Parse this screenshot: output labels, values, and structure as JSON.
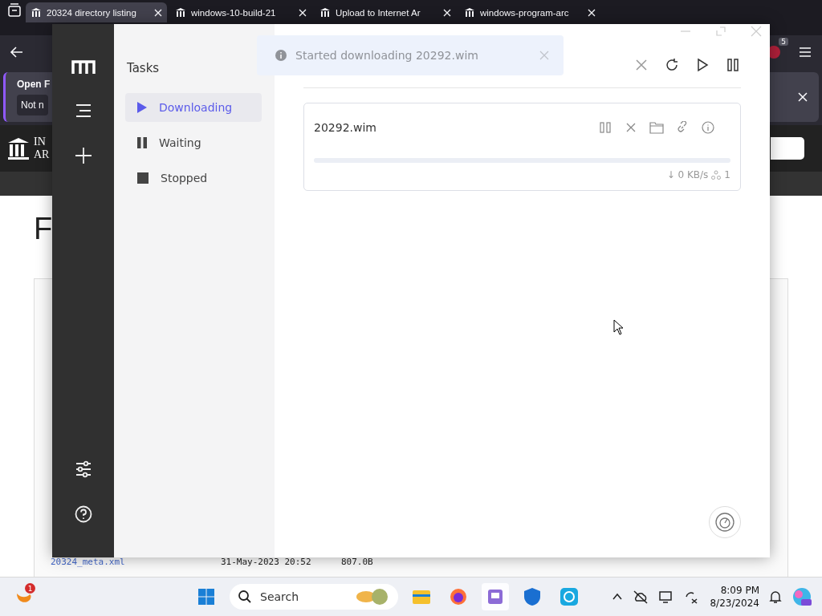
{
  "browser": {
    "tabs": [
      {
        "title": "20324 directory listing",
        "selected": true
      },
      {
        "title": "windows-10-build-21",
        "selected": false
      },
      {
        "title": "Upload to Internet Ar",
        "selected": false
      },
      {
        "title": "windows-program-arc",
        "selected": false
      }
    ],
    "extension_badge": "5",
    "notification": {
      "title": "Open F",
      "button": "Not n"
    },
    "site": {
      "logo_lines": [
        "IN",
        "AR"
      ],
      "heading": "F",
      "files": [
        {
          "name": "20324_meta.xml",
          "date": "31-May-2023 20:52",
          "size": "807.0B"
        }
      ]
    }
  },
  "motrix": {
    "sidebar_title": "Tasks",
    "categories": [
      {
        "label": "Downloading",
        "kind": "play",
        "selected": true
      },
      {
        "label": "Waiting",
        "kind": "pause",
        "selected": false
      },
      {
        "label": "Stopped",
        "kind": "stop",
        "selected": false
      }
    ],
    "toast": "Started downloading 20292.wim",
    "tasks": [
      {
        "name": "20292.wim",
        "level": 0,
        "speed": "↓ 0 KB/s",
        "connections": "1"
      }
    ]
  },
  "taskbar": {
    "notification_count": "1",
    "search_placeholder": "Search",
    "time": "8:09 PM",
    "date": "8/23/2024"
  }
}
